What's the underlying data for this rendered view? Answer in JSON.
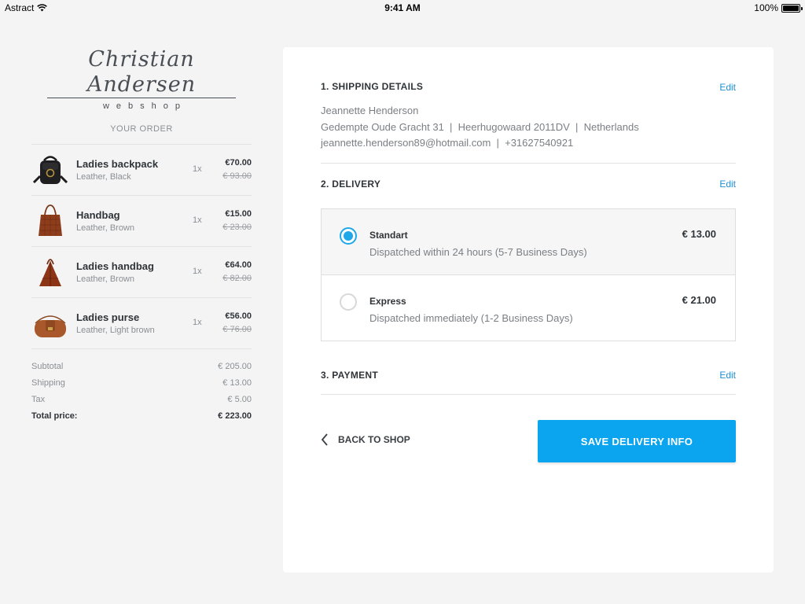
{
  "status_bar": {
    "carrier": "Astract",
    "time": "9:41 AM",
    "battery": "100%"
  },
  "brand": {
    "script": "Christian Andersen",
    "sub": "webshop"
  },
  "order": {
    "heading": "YOUR ORDER",
    "items": [
      {
        "name": "Ladies backpack",
        "desc": "Leather, Black",
        "qty": "1x",
        "price": "€70.00",
        "old_price": "€ 93.00",
        "icon": "backpack-image"
      },
      {
        "name": "Handbag",
        "desc": "Leather, Brown",
        "qty": "1x",
        "price": "€15.00",
        "old_price": "€ 23.00",
        "icon": "handbag-image"
      },
      {
        "name": "Ladies handbag",
        "desc": "Leather, Brown",
        "qty": "1x",
        "price": "€64.00",
        "old_price": "€ 82.00",
        "icon": "ladies-handbag-image"
      },
      {
        "name": "Ladies purse",
        "desc": "Leather, Light brown",
        "qty": "1x",
        "price": "€56.00",
        "old_price": "€ 76.00",
        "icon": "purse-image"
      }
    ],
    "totals": {
      "subtotal_label": "Subtotal",
      "subtotal": "€ 205.00",
      "shipping_label": "Shipping",
      "shipping": "€ 13.00",
      "tax_label": "Tax",
      "tax": "€ 5.00",
      "total_label": "Total price:",
      "total": "€ 223.00"
    }
  },
  "checkout": {
    "shipping": {
      "title": "1. SHIPPING DETAILS",
      "edit": "Edit",
      "name": "Jeannette Henderson",
      "address": "Gedempte Oude Gracht 31  |  Heerhugowaard 2011DV  |  Netherlands",
      "contact": "jeannette.henderson89@hotmail.com  |  +31627540921"
    },
    "delivery": {
      "title": "2. DELIVERY",
      "edit": "Edit",
      "options": [
        {
          "name": "Standart",
          "desc": "Dispatched within 24 hours (5-7 Business Days)",
          "price": "€ 13.00",
          "selected": true
        },
        {
          "name": "Express",
          "desc": "Dispatched immediately (1-2 Business Days)",
          "price": "€ 21.00",
          "selected": false
        }
      ]
    },
    "payment": {
      "title": "3. PAYMENT",
      "edit": "Edit"
    },
    "back_label": "BACK TO SHOP",
    "save_label": "SAVE DELIVERY INFO"
  },
  "colors": {
    "accent": "#0aa5ee",
    "link": "#1e8fd6",
    "radio": "#1ea8ea"
  }
}
